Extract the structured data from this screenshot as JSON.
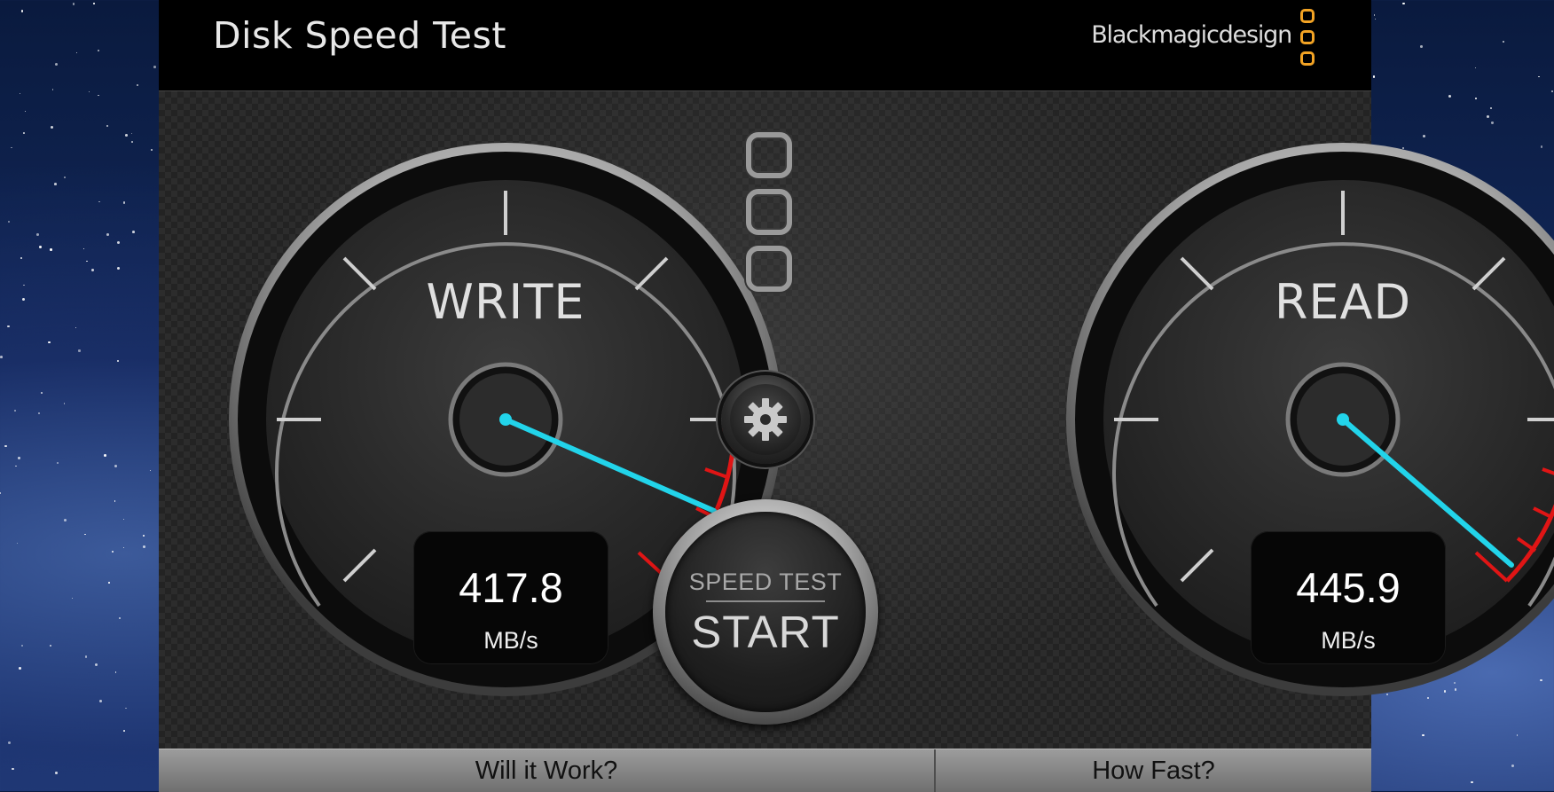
{
  "app": {
    "title": "Disk Speed Test",
    "brand": "Blackmagicdesign"
  },
  "gauges": {
    "write": {
      "label": "WRITE",
      "value": "417.8",
      "unit": "MB/s"
    },
    "read": {
      "label": "READ",
      "value": "445.9",
      "unit": "MB/s"
    }
  },
  "start_button": {
    "top_label": "SPEED TEST",
    "main_label": "START"
  },
  "bottom_tabs": {
    "will_it_work": "Will it Work?",
    "how_fast": "How Fast?"
  },
  "colors": {
    "needle": "#22d4ea",
    "redline": "#e01515",
    "brand_logo": "#f2a324"
  },
  "icons": {
    "settings": "gear-icon",
    "center_logo": "blackmagic-logo-icon"
  }
}
